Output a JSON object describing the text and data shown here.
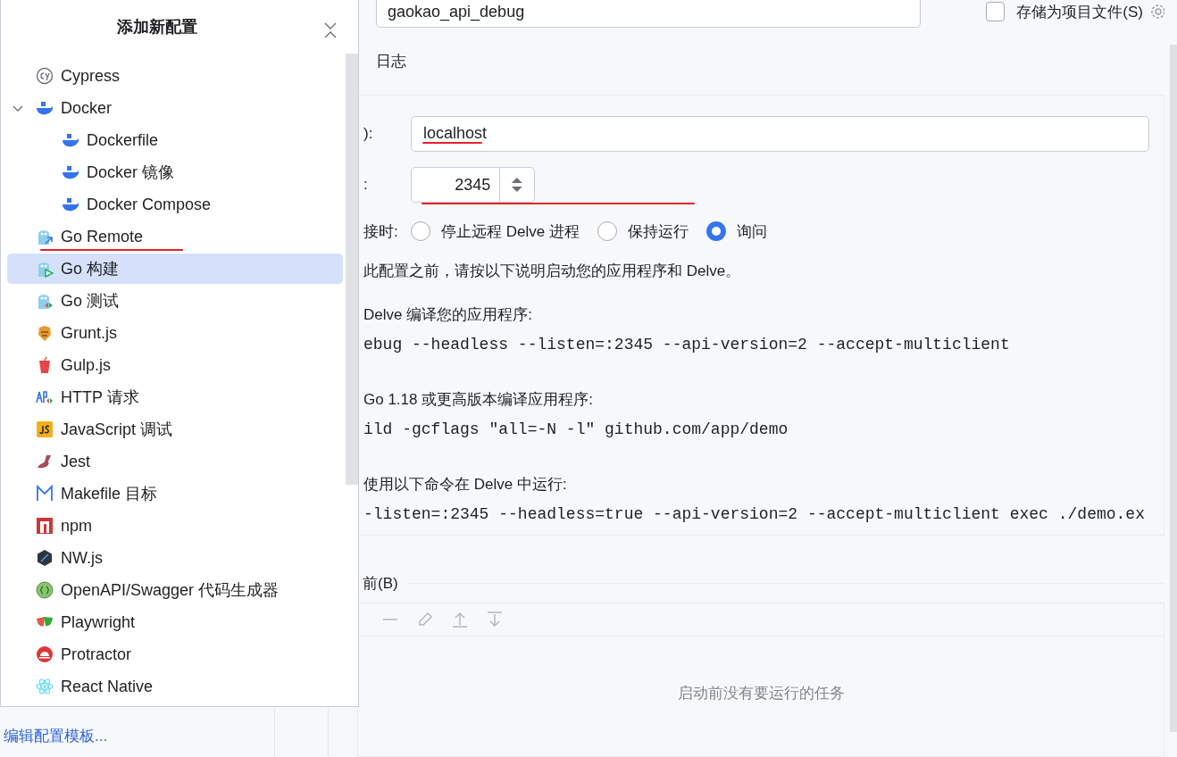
{
  "popup": {
    "title": "添加新配置",
    "items": [
      {
        "label": "Cypress",
        "kind": "cypress",
        "selected": false
      },
      {
        "label": "Docker",
        "kind": "docker",
        "selected": false,
        "expanded": true,
        "children": [
          {
            "label": "Dockerfile",
            "kind": "docker",
            "selected": false
          },
          {
            "label": "Docker 镜像",
            "kind": "docker",
            "selected": false
          },
          {
            "label": "Docker Compose",
            "kind": "docker",
            "selected": false
          }
        ]
      },
      {
        "label": "Go Remote",
        "kind": "goremote",
        "selected": false
      },
      {
        "label": "Go 构建",
        "kind": "gobuild",
        "selected": true
      },
      {
        "label": "Go 测试",
        "kind": "gotest",
        "selected": false
      },
      {
        "label": "Grunt.js",
        "kind": "grunt",
        "selected": false
      },
      {
        "label": "Gulp.js",
        "kind": "gulp",
        "selected": false
      },
      {
        "label": "HTTP 请求",
        "kind": "http",
        "selected": false
      },
      {
        "label": "JavaScript 调试",
        "kind": "js",
        "selected": false
      },
      {
        "label": "Jest",
        "kind": "jest",
        "selected": false
      },
      {
        "label": "Makefile 目标",
        "kind": "make",
        "selected": false
      },
      {
        "label": "npm",
        "kind": "npm",
        "selected": false
      },
      {
        "label": "NW.js",
        "kind": "nw",
        "selected": false
      },
      {
        "label": "OpenAPI/Swagger 代码生成器",
        "kind": "openapi",
        "selected": false
      },
      {
        "label": "Playwright",
        "kind": "playwright",
        "selected": false
      },
      {
        "label": "Protractor",
        "kind": "protractor",
        "selected": false
      },
      {
        "label": "React Native",
        "kind": "react",
        "selected": false
      }
    ]
  },
  "sidebar": {
    "link": "编辑配置模板..."
  },
  "name_field": {
    "value": "gaokao_api_debug"
  },
  "store_checkbox": {
    "label": "存储为项目文件(S)",
    "checked": false
  },
  "tabs": [
    {
      "label": "日志",
      "selected": false
    }
  ],
  "host": {
    "label": "):",
    "value": "localhost"
  },
  "port": {
    "label": ":",
    "value": "2345"
  },
  "disconnect": {
    "label": "接时:",
    "options": [
      {
        "label": "停止远程 Delve 进程",
        "selected": false
      },
      {
        "label": "保持运行",
        "selected": false
      },
      {
        "label": "询问",
        "selected": true
      }
    ]
  },
  "instructions": [
    {
      "kind": "text",
      "text": "此配置之前，请按以下说明启动您的应用程序和 Delve。"
    },
    {
      "kind": "text",
      "text": "Delve 编译您的应用程序:"
    },
    {
      "kind": "code",
      "text": "ebug --headless --listen=:2345 --api-version=2 --accept-multiclient"
    },
    {
      "kind": "text",
      "text": "Go 1.18 或更高版本编译应用程序:"
    },
    {
      "kind": "code",
      "text": "ild -gcflags \"all=-N -l\" github.com/app/demo"
    },
    {
      "kind": "text",
      "text": "使用以下命令在 Delve 中运行:"
    },
    {
      "kind": "code",
      "text": "-listen=:2345 --headless=true --api-version=2 --accept-multiclient exec ./demo.ex"
    }
  ],
  "before_launch": {
    "title": "前(B)",
    "empty_text": "启动前没有要运行的任务"
  }
}
